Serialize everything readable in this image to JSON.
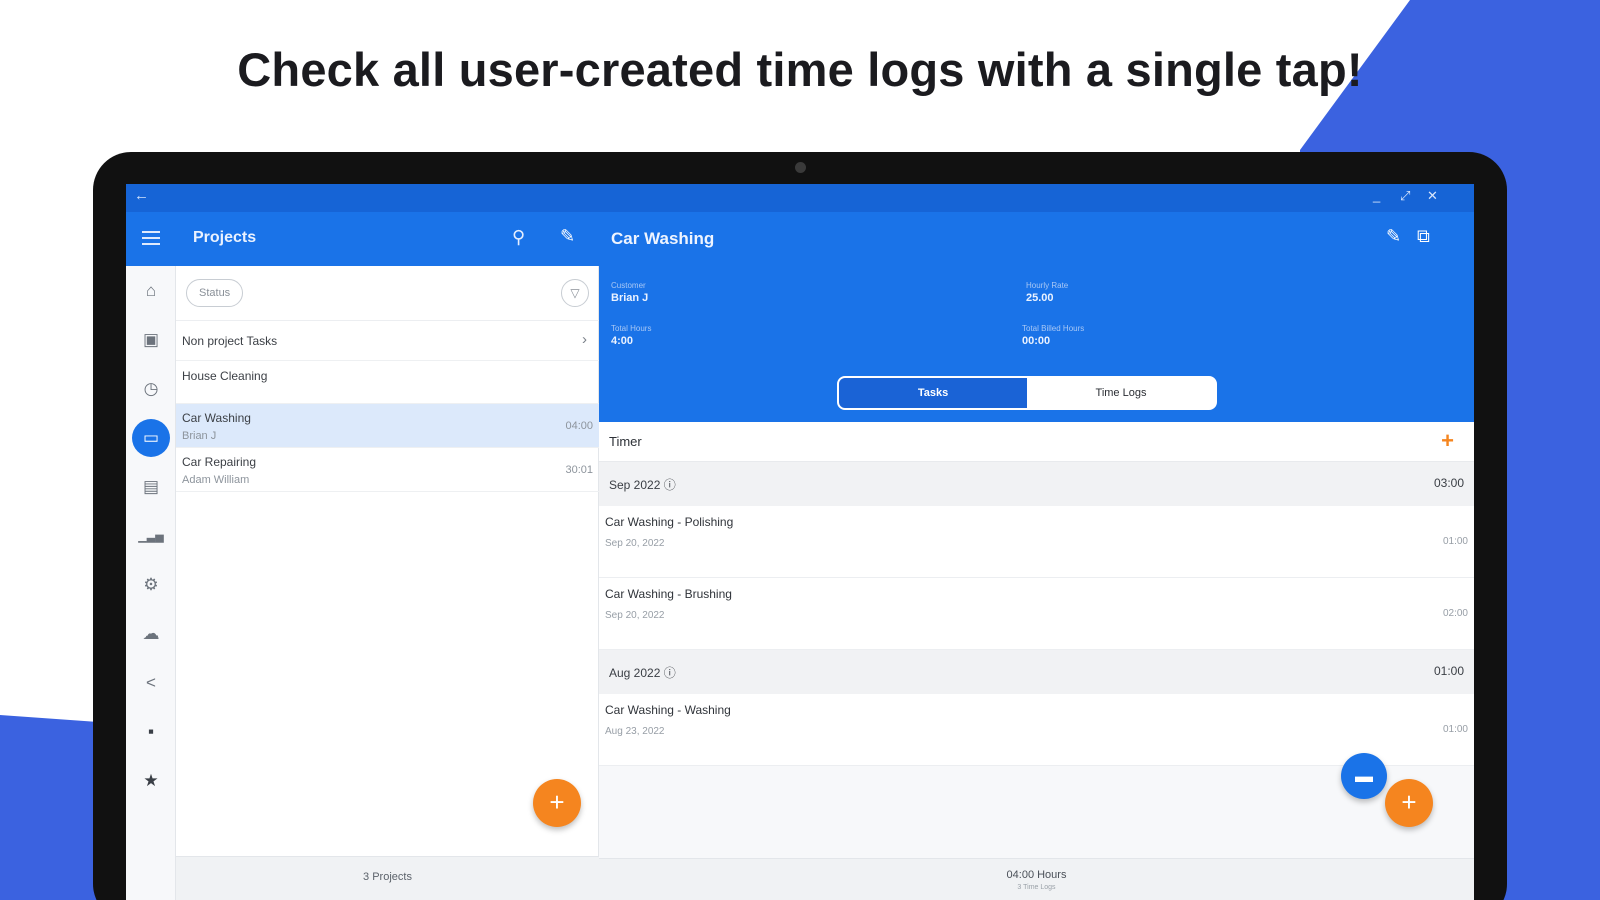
{
  "headline": "Check all user-created time logs with a single tap!",
  "colors": {
    "primary": "#1a73e8",
    "accent": "#f5851f",
    "background_shape": "#3b62e0"
  },
  "titlebar": {
    "back_icon": "back-arrow-icon",
    "minimize": "_",
    "maximize": "⤢",
    "close": "✕"
  },
  "rail": {
    "items": [
      {
        "icon": "home-icon",
        "glyph": "⌂"
      },
      {
        "icon": "contacts-icon",
        "glyph": "▣"
      },
      {
        "icon": "clock-icon",
        "glyph": "◷"
      },
      {
        "icon": "projects-icon",
        "glyph": "▭",
        "active": true
      },
      {
        "icon": "clipboard-icon",
        "glyph": "▤"
      },
      {
        "icon": "reports-icon",
        "glyph": "▁▃▅"
      },
      {
        "icon": "settings-icon",
        "glyph": "⚙"
      },
      {
        "icon": "cloud-icon",
        "glyph": "☁"
      },
      {
        "icon": "share-icon",
        "glyph": "<"
      },
      {
        "icon": "feedback-icon",
        "glyph": "▪"
      },
      {
        "icon": "star-icon",
        "glyph": "★"
      }
    ]
  },
  "projects": {
    "title": "Projects",
    "search_icon": "⚲",
    "edit_icon": "✎",
    "status_chip": "Status",
    "filter_icon": "▽",
    "items": [
      {
        "name": "Non project Tasks",
        "chevron": "›"
      },
      {
        "name": "House Cleaning"
      },
      {
        "name": "Car Washing",
        "sub": "Brian J",
        "hours": "04:00",
        "selected": true
      },
      {
        "name": "Car Repairing",
        "sub": "Adam William",
        "hours": "30:01"
      }
    ],
    "fab": "+",
    "footer": "3 Projects"
  },
  "detail": {
    "title": "Car Washing",
    "edit_icon": "✎",
    "copy_icon": "⧉",
    "fields": {
      "customer_label": "Customer",
      "customer_value": "Brian J",
      "hourly_rate_label": "Hourly Rate",
      "hourly_rate_value": "25.00",
      "total_hours_label": "Total Hours",
      "total_hours_value": "4:00",
      "total_billed_label": "Total Billed Hours",
      "total_billed_value": "00:00"
    },
    "segment": {
      "tasks": "Tasks",
      "time_logs": "Time Logs",
      "selected": "Tasks"
    },
    "timer": {
      "label": "Timer",
      "add": "+"
    },
    "groups": [
      {
        "label": "Sep 2022 ⓘ",
        "total": "03:00",
        "logs": [
          {
            "name": "Car Washing - Polishing",
            "date": "Sep 20, 2022",
            "hours": "01:00"
          },
          {
            "name": "Car Washing - Brushing",
            "date": "Sep 20, 2022",
            "hours": "02:00"
          }
        ]
      },
      {
        "label": "Aug 2022 ⓘ",
        "total": "01:00",
        "logs": [
          {
            "name": "Car Washing - Washing",
            "date": "Aug 23, 2022",
            "hours": "01:00"
          }
        ]
      }
    ],
    "chat_icon": "▬",
    "fab": "+",
    "footer_main": "04:00 Hours",
    "footer_sub": "3 Time Logs"
  }
}
